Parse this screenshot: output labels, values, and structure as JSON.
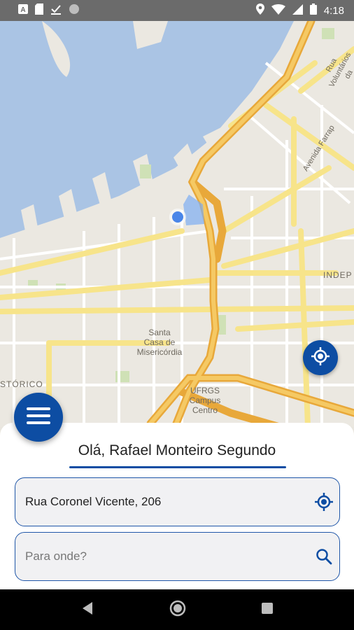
{
  "status_bar": {
    "time": "4:18",
    "left_icons": [
      "app-a-icon",
      "sd-card-icon",
      "download-done-icon",
      "sync-circle-icon"
    ],
    "right_icons": [
      "location-pin-icon",
      "wifi-icon",
      "signal-icon",
      "battery-icon"
    ]
  },
  "map": {
    "labels": {
      "santa_casa": "Santa\nCasa de\nMisericórdia",
      "ufrgs": "UFRGS\nCampus\nCentro",
      "historico": "STÓRICO",
      "indep": "INDEP",
      "avenida_farrapos": "Avenida Farrap",
      "rua_voluntarios": "Rua Voluntários da"
    }
  },
  "greeting": "Olá, Rafael Monteiro Segundo",
  "origin": {
    "value": "Rua Coronel Vicente, 206"
  },
  "destination": {
    "placeholder": "Para onde?"
  },
  "colors": {
    "accent": "#0d4da3",
    "water": "#aac4e4",
    "road_major": "#f2c14e",
    "road_minor": "#f7e48a"
  }
}
